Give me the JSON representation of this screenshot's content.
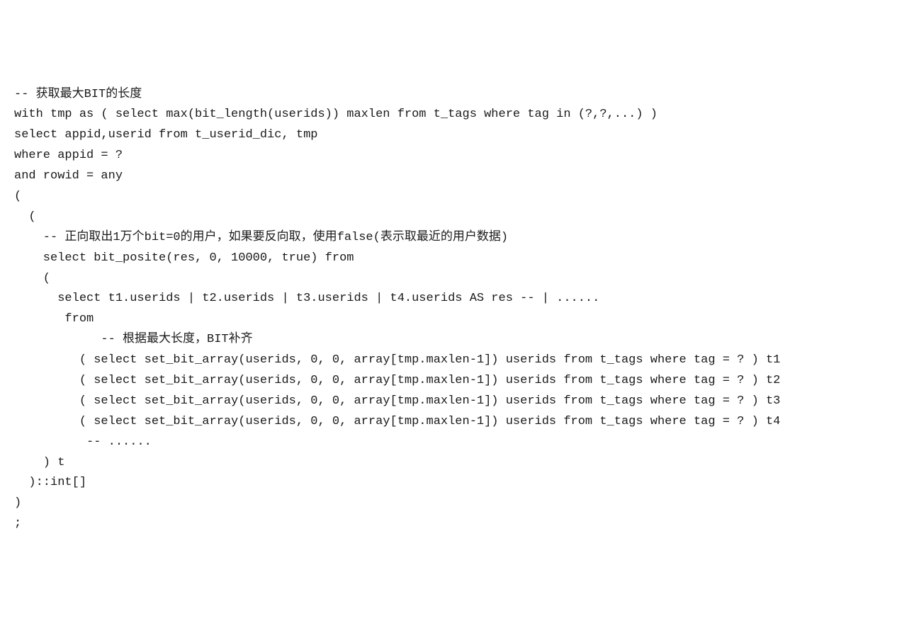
{
  "code": {
    "lines": [
      "-- 获取最大BIT的长度",
      "with tmp as ( select max(bit_length(userids)) maxlen from t_tags where tag in (?,?,...) )",
      "select appid,userid from t_userid_dic, tmp",
      "where appid = ?",
      "and rowid = any",
      "(",
      "  (",
      "    -- 正向取出1万个bit=0的用户，如果要反向取，使用false(表示取最近的用户数据)",
      "    select bit_posite(res, 0, 10000, true) from",
      "    (",
      "      select t1.userids | t2.userids | t3.userids | t4.userids AS res -- | ......",
      "       from",
      "            -- 根据最大长度，BIT补齐",
      "         ( select set_bit_array(userids, 0, 0, array[tmp.maxlen-1]) userids from t_tags where tag = ? ) t1",
      "         ( select set_bit_array(userids, 0, 0, array[tmp.maxlen-1]) userids from t_tags where tag = ? ) t2",
      "         ( select set_bit_array(userids, 0, 0, array[tmp.maxlen-1]) userids from t_tags where tag = ? ) t3",
      "         ( select set_bit_array(userids, 0, 0, array[tmp.maxlen-1]) userids from t_tags where tag = ? ) t4",
      "          -- ......",
      "    ) t",
      "  )::int[]",
      ")",
      ";"
    ]
  }
}
